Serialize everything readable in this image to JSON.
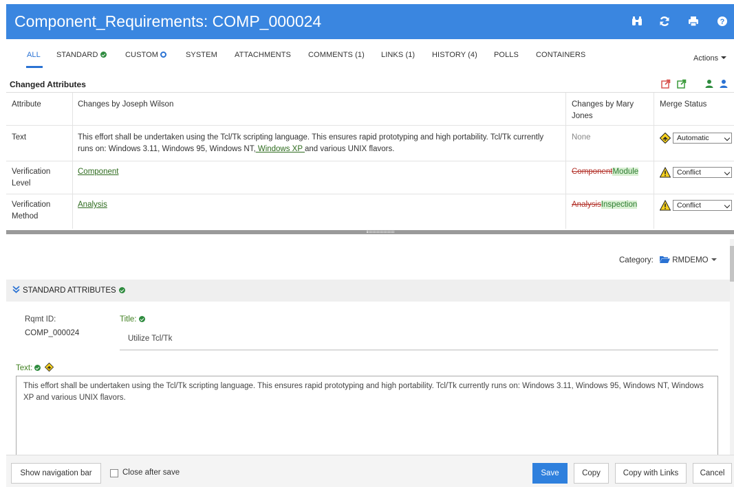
{
  "header": {
    "title": "Component_Requirements: COMP_000024",
    "icons": [
      "binoculars-icon",
      "refresh-icon",
      "print-icon",
      "help-icon"
    ]
  },
  "tabs": [
    {
      "label": "ALL",
      "active": true
    },
    {
      "label": "STANDARD",
      "badge": "check"
    },
    {
      "label": "CUSTOM",
      "badge": "ring"
    },
    {
      "label": "SYSTEM"
    },
    {
      "label": "ATTACHMENTS"
    },
    {
      "label": "COMMENTS (1)"
    },
    {
      "label": "LINKS (1)"
    },
    {
      "label": "HISTORY (4)"
    },
    {
      "label": "POLLS"
    },
    {
      "label": "CONTAINERS"
    }
  ],
  "actions_label": "Actions",
  "changed": {
    "title": "Changed Attributes",
    "columns": [
      "Attribute",
      "Changes by Joseph Wilson",
      "Changes by Mary Jones",
      "Merge Status"
    ],
    "rows": [
      {
        "attribute": "Text",
        "changes_a_pre": "This effort shall be undertaken using the Tcl/Tk scripting language. This ensures rapid prototyping and high portability. Tcl/Tk currently runs on: Windows 3.11, Windows 95, Windows NT,",
        "changes_a_link": " Windows XP ",
        "changes_a_post": " and various UNIX flavors.",
        "changes_b": "None",
        "merge": "Automatic"
      },
      {
        "attribute": "Verification Level",
        "changes_a_link": "Component",
        "changes_b_del": "Component",
        "changes_b_ins": "Module",
        "merge": "Conflict"
      },
      {
        "attribute": "Verification Method",
        "changes_a_link": "Analysis",
        "changes_b_del": "Analysis",
        "changes_b_ins": "Inspection",
        "merge": "Conflict"
      }
    ]
  },
  "category": {
    "label": "Category:",
    "value": "RMDEMO"
  },
  "standard": {
    "header": "STANDARD ATTRIBUTES",
    "rqmt_id_label": "Rqmt ID:",
    "rqmt_id_value": "COMP_000024",
    "title_label": "Title:",
    "title_value": "Utilize Tcl/Tk",
    "text_label": "Text:",
    "text_value": "This effort shall be undertaken using the Tcl/Tk scripting language. This ensures rapid prototyping and high portability. Tcl/Tk currently runs on: Windows 3.11, Windows 95, Windows NT, Windows XP  and various UNIX flavors."
  },
  "footer": {
    "show_nav": "Show navigation bar",
    "close_after_save": "Close after save",
    "close_after_save_checked": false,
    "save": "Save",
    "copy": "Copy",
    "copy_links": "Copy with Links",
    "cancel": "Cancel"
  },
  "colors": {
    "header_bg": "#3a86e0",
    "accent": "#2a72d3",
    "primary_button": "#2f80dd",
    "success": "#2e8b3e",
    "conflict": "#f5d020"
  }
}
